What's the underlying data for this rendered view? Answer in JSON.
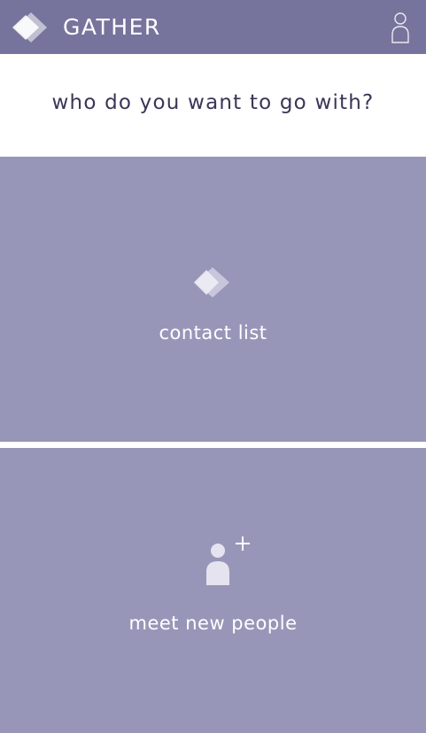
{
  "header": {
    "app_title": "GATHER",
    "logo_icon": "gather-diamond-logo",
    "profile_icon": "user-profile-icon"
  },
  "prompt": {
    "question": "who do you want to go with?"
  },
  "options": [
    {
      "label": "contact list",
      "icon": "gather-diamond-icon"
    },
    {
      "label": "meet new people",
      "icon": "add-person-icon"
    }
  ],
  "colors": {
    "header_bg": "#76749c",
    "card_bg": "#9896b8",
    "question_text": "#3a3658",
    "icon_light": "#d8d6e8"
  }
}
